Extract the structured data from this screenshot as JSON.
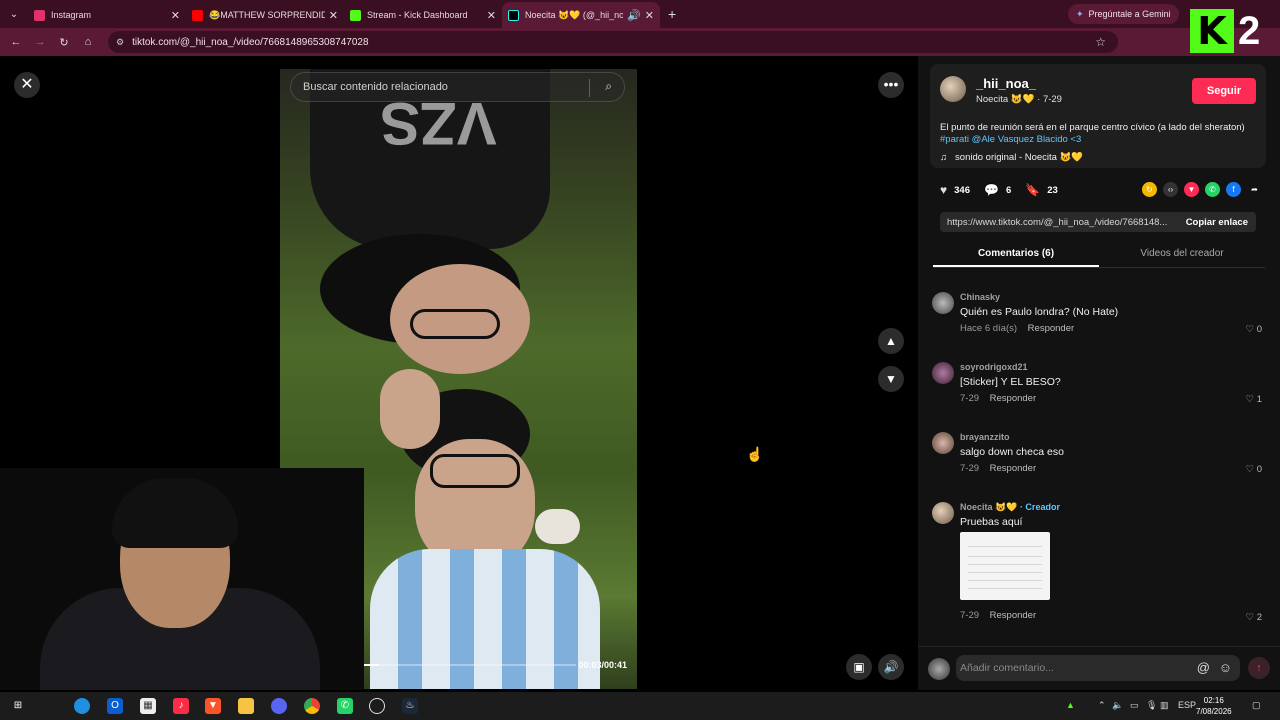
{
  "browser": {
    "tabs": [
      {
        "title": "Instagram",
        "color": "#e1306c",
        "active": false
      },
      {
        "title": "😂MATTHEW SORPRENDIDO",
        "color": "#ff0000",
        "active": false
      },
      {
        "title": "Stream - Kick Dashboard",
        "color": "#53fc18",
        "active": false
      },
      {
        "title": "Noecita 😺💛 (@_hii_noa_",
        "color": "#000000",
        "active": true
      }
    ],
    "new_tab": "+",
    "gemini_label": "Pregúntale a Gemini",
    "url": "tiktok.com/@_hii_noa_/video/7668148965308747028"
  },
  "overlay": {
    "brand_letter": "K",
    "brand_number": "2"
  },
  "video": {
    "search_placeholder": "Buscar contenido relacionado",
    "time": "00:03/00:41",
    "progress": 0.07
  },
  "post": {
    "username": "_hii_noa_",
    "display": "Noecita 😺💛 · 7-29",
    "follow_label": "Seguir",
    "description": "El punto de reunión será en el parque centro cívico (a lado del sheraton)",
    "tags": "#parati @Ale Vasquez Blacido <3",
    "sound": "sonido original - Noecita 😺💛",
    "likes": "346",
    "comments": "6",
    "saves": "23",
    "link": "https://www.tiktok.com/@_hii_noa_/video/7668148...",
    "copy_label": "Copiar enlace"
  },
  "tabs": {
    "comments": "Comentarios (6)",
    "creator_videos": "Videos del creador"
  },
  "comments": [
    {
      "user": "Chinasky",
      "text": "Quién es Paulo londra? (No Hate)",
      "meta": "Hace 6 día(s)",
      "reply": "Responder",
      "likes": "0"
    },
    {
      "user": "soyrodrigoxd21",
      "text": "[Sticker] Y EL BESO?",
      "meta": "7-29",
      "reply": "Responder",
      "likes": "1"
    },
    {
      "user": "brayanzzito",
      "text": "salgo down checa eso",
      "meta": "7-29",
      "reply": "Responder",
      "likes": "0"
    },
    {
      "user": "Noecita 😺💛",
      "creator": " · Creador",
      "text": "Pruebas aquí",
      "meta": "7-29",
      "reply": "Responder",
      "likes": "2"
    }
  ],
  "add_comment_placeholder": "Añadir comentario...",
  "taskbar": {
    "language": "ESP",
    "time": "02:16",
    "date": "7/08/2026"
  }
}
